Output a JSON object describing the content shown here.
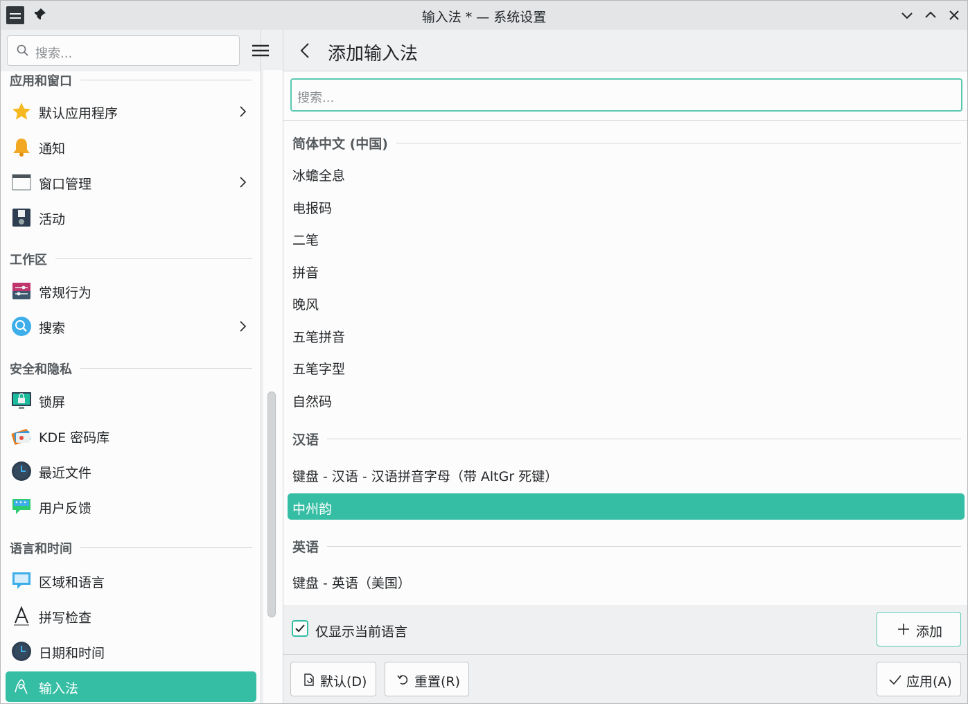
{
  "window": {
    "title": "输入法 * — 系统设置"
  },
  "sidebar": {
    "search_placeholder": "搜索...",
    "sections": [
      {
        "label": "应用和窗口",
        "items": [
          {
            "label": "默认应用程序",
            "icon": "star-icon",
            "has_chevron": true
          },
          {
            "label": "通知",
            "icon": "bell-icon",
            "has_chevron": false
          },
          {
            "label": "窗口管理",
            "icon": "window-icon",
            "has_chevron": true
          },
          {
            "label": "活动",
            "icon": "activities-icon",
            "has_chevron": false
          }
        ]
      },
      {
        "label": "工作区",
        "items": [
          {
            "label": "常规行为",
            "icon": "sliders-icon",
            "has_chevron": false
          },
          {
            "label": "搜索",
            "icon": "magnifier-icon",
            "has_chevron": true
          }
        ]
      },
      {
        "label": "安全和隐私",
        "items": [
          {
            "label": "锁屏",
            "icon": "lock-screen-icon",
            "has_chevron": false
          },
          {
            "label": "KDE 密码库",
            "icon": "wallet-icon",
            "has_chevron": false
          },
          {
            "label": "最近文件",
            "icon": "clock-icon",
            "has_chevron": false
          },
          {
            "label": "用户反馈",
            "icon": "feedback-icon",
            "has_chevron": false
          }
        ]
      },
      {
        "label": "语言和时间",
        "items": [
          {
            "label": "区域和语言",
            "icon": "speech-bubble-icon",
            "has_chevron": false
          },
          {
            "label": "拼写检查",
            "icon": "letter-a-icon",
            "has_chevron": false
          },
          {
            "label": "日期和时间",
            "icon": "clock-icon",
            "has_chevron": false
          },
          {
            "label": "输入法",
            "icon": "input-method-icon",
            "has_chevron": false,
            "active": true
          }
        ]
      }
    ]
  },
  "main": {
    "page_title": "添加输入法",
    "search_placeholder": "搜索...",
    "groups": [
      {
        "label": "简体中文 (中国)",
        "items": [
          "冰蟾全息",
          "电报码",
          "二笔",
          "拼音",
          "晚风",
          "五笔拼音",
          "五笔字型",
          "自然码"
        ]
      },
      {
        "label": "汉语",
        "items": [
          "键盘 - 汉语 - 汉语拼音字母（带 AltGr 死键）",
          "中州韵"
        ]
      },
      {
        "label": "英语",
        "items": [
          "键盘 - 英语（美国）"
        ]
      }
    ],
    "selected_item": "中州韵",
    "show_current_language_only": {
      "label": "仅显示当前语言",
      "checked": true
    },
    "add_button": "添加"
  },
  "footer": {
    "defaults_button": "默认(D)",
    "reset_button": "重置(R)",
    "apply_button": "应用(A)"
  },
  "colors": {
    "accent": "#35bea4",
    "window_bg": "#eff0f1",
    "view_bg": "#fcfcfc",
    "text": "#232629"
  }
}
